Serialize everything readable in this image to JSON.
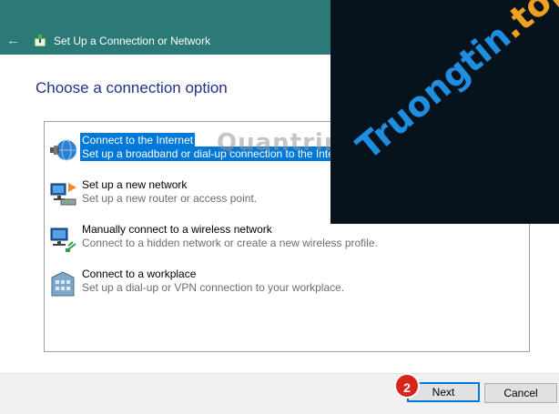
{
  "window": {
    "title": "Set Up a Connection or Network",
    "back_icon": "back-arrow-icon",
    "title_bar_color": "#2b7a78"
  },
  "main": {
    "heading": "Choose a connection option"
  },
  "options": [
    {
      "label": "Connect to the Internet",
      "description": "Set up a broadband or dial-up connection to the Internet.",
      "icon": "globe-network-icon",
      "selected": true
    },
    {
      "label": "Set up a new network",
      "description": "Set up a new router or access point.",
      "icon": "router-icon",
      "selected": false
    },
    {
      "label": "Manually connect to a wireless network",
      "description": "Connect to a hidden network or create a new wireless profile.",
      "icon": "wireless-computer-icon",
      "selected": false
    },
    {
      "label": "Connect to a workplace",
      "description": "Set up a dial-up or VPN connection to your workplace.",
      "icon": "workplace-building-icon",
      "selected": false
    }
  ],
  "buttons": {
    "next": "Next",
    "cancel": "Cancel"
  },
  "annotation": {
    "step_number": "2",
    "color": "#d9261c"
  },
  "watermarks": {
    "center_text": "Quantrimang",
    "overlay_brand": "Truongtin",
    "overlay_dot": ".",
    "overlay_tld": "top"
  },
  "colors": {
    "selection": "#0078d7",
    "heading": "#1e3287"
  }
}
